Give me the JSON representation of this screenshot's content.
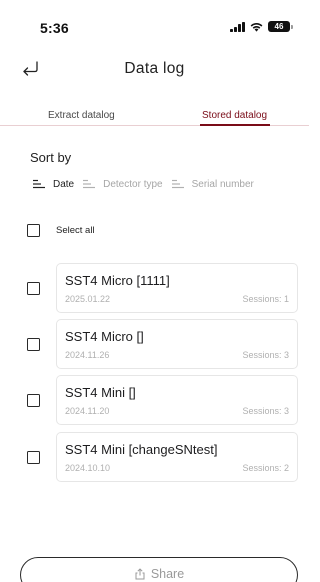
{
  "status_bar": {
    "time": "5:36",
    "battery": "46"
  },
  "header": {
    "title": "Data log",
    "back_icon": "return-arrow-icon"
  },
  "tabs": [
    {
      "label": "Extract datalog",
      "active": false
    },
    {
      "label": "Stored datalog",
      "active": true
    }
  ],
  "sort": {
    "label": "Sort by",
    "options": [
      {
        "label": "Date",
        "active": true
      },
      {
        "label": "Detector type",
        "active": false
      },
      {
        "label": "Serial number",
        "active": false
      }
    ]
  },
  "select_all": {
    "label": "Select all",
    "checked": false
  },
  "items": [
    {
      "title": "SST4 Micro [1111]",
      "date": "2025.01.22",
      "sessions": "Sessions: 1",
      "checked": false
    },
    {
      "title": "SST4 Micro []",
      "date": "2024.11.26",
      "sessions": "Sessions: 3",
      "checked": false
    },
    {
      "title": "SST4 Mini []",
      "date": "2024.11.20",
      "sessions": "Sessions: 3",
      "checked": false
    },
    {
      "title": "SST4 Mini [changeSNtest]",
      "date": "2024.10.10",
      "sessions": "Sessions: 2",
      "checked": false
    }
  ],
  "footer": {
    "share_label": "Share",
    "share_icon": "share-icon"
  },
  "colors": {
    "accent": "#7a0c18",
    "muted_text": "#b0b0b0",
    "card_border": "#e6e6e6"
  }
}
